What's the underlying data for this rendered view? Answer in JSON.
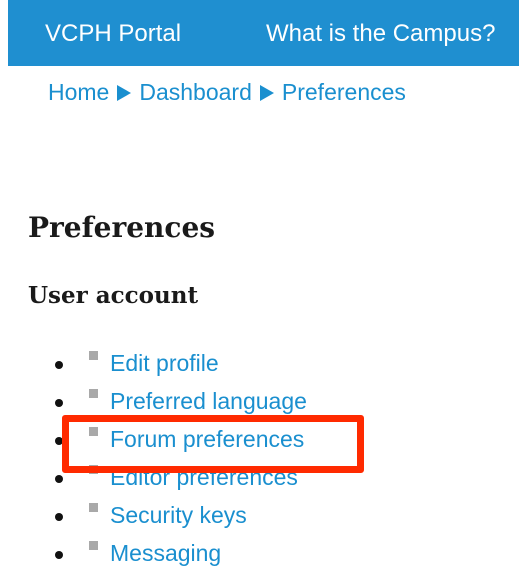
{
  "topnav": {
    "items": [
      {
        "label": "VCPH Portal"
      },
      {
        "label": "What is the Campus?"
      }
    ],
    "background_color": "#1f8fd0"
  },
  "breadcrumb": {
    "items": [
      {
        "label": "Home"
      },
      {
        "label": "Dashboard"
      },
      {
        "label": "Preferences"
      }
    ],
    "separator_icon": "triangle-right-icon"
  },
  "page": {
    "title": "Preferences",
    "section_title": "User account"
  },
  "preferences": {
    "items": [
      {
        "label": "Edit profile"
      },
      {
        "label": "Preferred language"
      },
      {
        "label": "Forum preferences"
      },
      {
        "label": "Editor preferences"
      },
      {
        "label": "Security keys"
      },
      {
        "label": "Messaging"
      }
    ],
    "highlighted": "Forum preferences",
    "highlight_color": "#ff2a00",
    "link_color": "#1a8fcf"
  }
}
